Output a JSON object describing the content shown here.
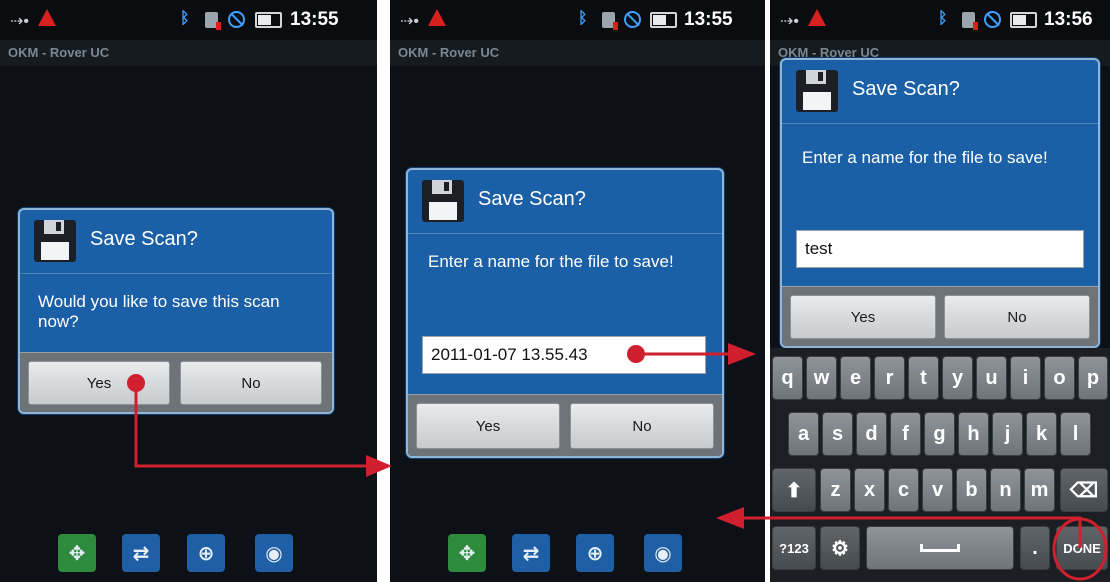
{
  "status_bar": {
    "times": [
      "13:55",
      "13:55",
      "13:56"
    ],
    "usb_icon": "usb-icon",
    "warning_icon": "warning-icon",
    "bluetooth_icon": "bluetooth-icon",
    "sim_icon": "sim-icon",
    "no_signal_icon": "no-signal-icon",
    "battery_icon": "battery-icon"
  },
  "app": {
    "title": "OKM - Rover UC"
  },
  "dialog": {
    "title": "Save Scan?",
    "icon": "floppy-disk-icon",
    "question": "Would you like to save this scan now?",
    "prompt": "Enter a name for the file to save!",
    "yes_label": "Yes",
    "no_label": "No"
  },
  "panel2": {
    "filename_value": "2011-01-07 13.55.43"
  },
  "panel3": {
    "filename_value": "test"
  },
  "toolbar": {
    "icons": [
      "move-icon",
      "sync-icon",
      "zoom-in-icon",
      "eye-icon"
    ]
  },
  "keyboard": {
    "row1": [
      "q",
      "w",
      "e",
      "r",
      "t",
      "y",
      "u",
      "i",
      "o",
      "p"
    ],
    "row2": [
      "a",
      "s",
      "d",
      "f",
      "g",
      "h",
      "j",
      "k",
      "l"
    ],
    "row3": [
      "z",
      "x",
      "c",
      "v",
      "b",
      "n",
      "m"
    ],
    "symbols_label": "?123",
    "period_label": ".",
    "done_label": "DONE"
  },
  "colors": {
    "dialog_blue": "#1b5fa6",
    "annotation_red": "#d01f2e",
    "screen_background": "#0d1117"
  }
}
